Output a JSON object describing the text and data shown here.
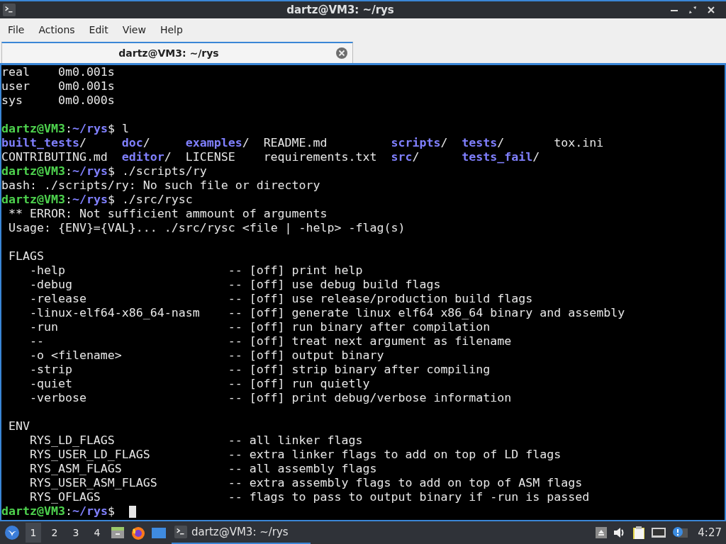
{
  "window": {
    "title": "dartz@VM3: ~/rys"
  },
  "menu": [
    "File",
    "Actions",
    "Edit",
    "View",
    "Help"
  ],
  "tabs": [
    {
      "label": "dartz@VM3: ~/rys",
      "selected": true
    }
  ],
  "terminal": [
    {
      "kind": "output",
      "text": "real    0m0.001s"
    },
    {
      "kind": "output",
      "text": "user    0m0.001s"
    },
    {
      "kind": "output",
      "text": "sys     0m0.000s"
    },
    {
      "kind": "blank"
    },
    {
      "kind": "prompt",
      "user": "dartz@VM3",
      "sep": ":",
      "path": "~/rys",
      "symbol": "$",
      "command": "l"
    },
    {
      "kind": "listing",
      "rows": [
        [
          {
            "name": "built_tests",
            "suffix": "/",
            "dir": true
          },
          {
            "name": "doc",
            "suffix": "/",
            "dir": true
          },
          {
            "name": "examples",
            "suffix": "/",
            "dir": true
          },
          {
            "name": "README.md",
            "dir": false
          },
          {
            "name": "scripts",
            "suffix": "/",
            "dir": true
          },
          {
            "name": "tests",
            "suffix": "/",
            "dir": true
          },
          {
            "name": "tox.ini",
            "dir": false
          }
        ],
        [
          {
            "name": "CONTRIBUTING.md",
            "dir": false
          },
          {
            "name": "editor",
            "suffix": "/",
            "dir": true
          },
          {
            "name": "LICENSE",
            "dir": false
          },
          {
            "name": "requirements.txt",
            "dir": false
          },
          {
            "name": "src",
            "suffix": "/",
            "dir": true
          },
          {
            "name": "tests_fail",
            "suffix": "/",
            "dir": true
          }
        ]
      ]
    },
    {
      "kind": "prompt",
      "user": "dartz@VM3",
      "sep": ":",
      "path": "~/rys",
      "symbol": "$",
      "command": "./scripts/ry"
    },
    {
      "kind": "output",
      "text": "bash: ./scripts/ry: No such file or directory"
    },
    {
      "kind": "prompt",
      "user": "dartz@VM3",
      "sep": ":",
      "path": "~/rys",
      "symbol": "$",
      "command": "./src/rysc"
    },
    {
      "kind": "output",
      "text": " ** ERROR: Not sufficient ammount of arguments"
    },
    {
      "kind": "output",
      "text": " Usage: {ENV}={VAL}... ./src/rysc <file | -help> -flag(s)"
    },
    {
      "kind": "blank"
    },
    {
      "kind": "output",
      "text": " FLAGS"
    },
    {
      "kind": "option",
      "name": "-help",
      "text": "-- [off] print help"
    },
    {
      "kind": "option",
      "name": "-debug",
      "text": "-- [off] use debug build flags"
    },
    {
      "kind": "option",
      "name": "-release",
      "text": "-- [off] use release/production build flags"
    },
    {
      "kind": "option",
      "name": "-linux-elf64-x86_64-nasm",
      "text": "-- [off] generate linux elf64 x86_64 binary and assembly"
    },
    {
      "kind": "option",
      "name": "-run",
      "text": "-- [off] run binary after compilation"
    },
    {
      "kind": "option",
      "name": "--",
      "text": "-- [off] treat next argument as filename"
    },
    {
      "kind": "option",
      "name": "-o <filename>",
      "text": "-- [off] output binary"
    },
    {
      "kind": "option",
      "name": "-strip",
      "text": "-- [off] strip binary after compiling"
    },
    {
      "kind": "option",
      "name": "-quiet",
      "text": "-- [off] run quietly"
    },
    {
      "kind": "option",
      "name": "-verbose",
      "text": "-- [off] print debug/verbose information"
    },
    {
      "kind": "blank"
    },
    {
      "kind": "output",
      "text": " ENV"
    },
    {
      "kind": "option",
      "name": "RYS_LD_FLAGS",
      "text": "-- all linker flags"
    },
    {
      "kind": "option",
      "name": "RYS_USER_LD_FLAGS",
      "text": "-- extra linker flags to add on top of LD flags"
    },
    {
      "kind": "option",
      "name": "RYS_ASM_FLAGS",
      "text": "-- all assembly flags"
    },
    {
      "kind": "option",
      "name": "RYS_USER_ASM_FLAGS",
      "text": "-- extra assembly flags to add on top of ASM flags"
    },
    {
      "kind": "option",
      "name": "RYS_OFLAGS",
      "text": "-- flags to pass to output binary if -run is passed"
    },
    {
      "kind": "prompt",
      "user": "dartz@VM3",
      "sep": ":",
      "path": "~/rys",
      "symbol": "$",
      "cursor": true
    }
  ],
  "taskbar": {
    "desktops": [
      {
        "label": "1",
        "selected": true
      },
      {
        "label": "2",
        "selected": false
      },
      {
        "label": "3",
        "selected": false
      },
      {
        "label": "4",
        "selected": false
      }
    ],
    "tasks": [
      {
        "label": "dartz@VM3: ~/rys",
        "selected": true
      }
    ],
    "clock": "4:27"
  }
}
